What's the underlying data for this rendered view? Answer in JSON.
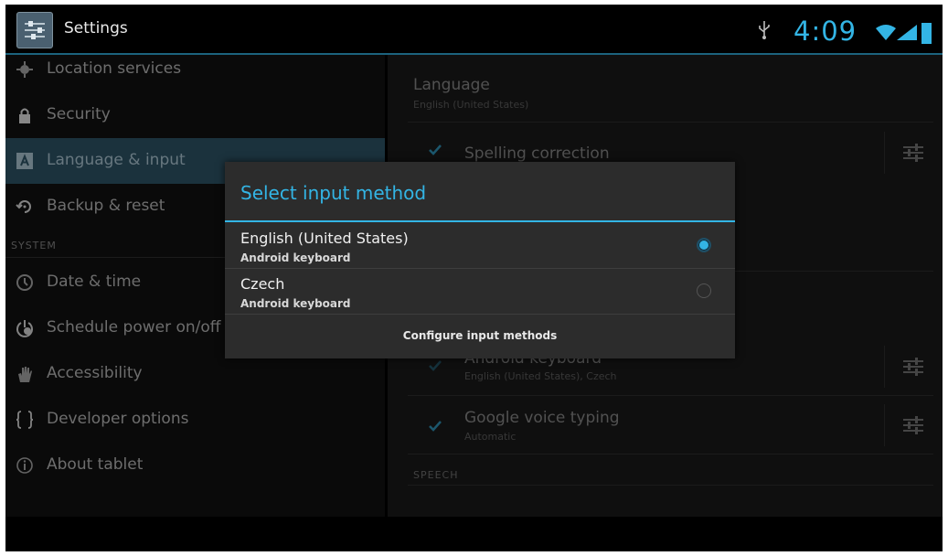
{
  "action_bar": {
    "title": "Settings",
    "time": "4:09",
    "accent": "#33b5e5",
    "icons": [
      "settings-app-icon",
      "usb-icon",
      "wifi-icon",
      "signal-icon",
      "battery-icon"
    ]
  },
  "left_nav": {
    "items_top": [
      {
        "label": "Location services",
        "icon": "location-icon"
      },
      {
        "label": "Security",
        "icon": "lock-icon"
      },
      {
        "label": "Language & input",
        "icon": "keyboard-icon",
        "selected": true
      },
      {
        "label": "Backup & reset",
        "icon": "backup-icon"
      }
    ],
    "section_system": "SYSTEM",
    "items_system": [
      {
        "label": "Date & time",
        "icon": "clock-icon"
      },
      {
        "label": "Schedule power on/off",
        "icon": "power-schedule-icon"
      },
      {
        "label": "Accessibility",
        "icon": "hand-icon"
      },
      {
        "label": "Developer options",
        "icon": "braces-icon"
      },
      {
        "label": "About tablet",
        "icon": "info-icon"
      }
    ]
  },
  "right_pane": {
    "language": {
      "title": "Language",
      "value": "English (United States)"
    },
    "spelling": {
      "title": "Spelling correction",
      "checked": true
    },
    "android_keyboard": {
      "title": "Android keyboard",
      "subtitle": "English (United States), Czech",
      "checked": true
    },
    "voice_typing": {
      "title": "Google voice typing",
      "subtitle": "Automatic",
      "checked": true
    },
    "speech_header": "SPEECH"
  },
  "dialog": {
    "title": "Select input method",
    "items": [
      {
        "title": "English (United States)",
        "subtitle": "Android keyboard",
        "selected": true
      },
      {
        "title": "Czech",
        "subtitle": "Android keyboard",
        "selected": false
      }
    ],
    "configure_label": "Configure input methods"
  }
}
